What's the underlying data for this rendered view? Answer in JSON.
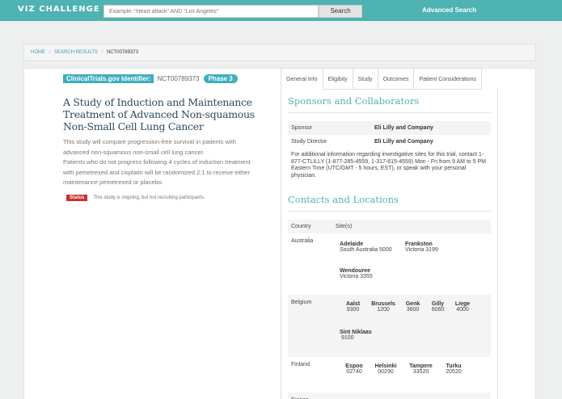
{
  "header": {
    "brand": "VIZ CHALLENGE",
    "search_placeholder": "Example: \"Heart attack\" AND \"Los Angeles\"",
    "search_button": "Search",
    "advanced_search": "Advanced Search"
  },
  "breadcrumb": {
    "home": "HOME",
    "separator": "/",
    "results": "SEARCH RESULTS",
    "current": "NCT00789373"
  },
  "study": {
    "id_label": "ClinicalTrials.gov Identifier:",
    "id_value": "NCT00789373",
    "phase": "Phase 3",
    "title": "A Study of Induction and Maintenance Treatment of Advanced Non-squamous Non-Small Cell Lung Cancer",
    "summary": "This study will compare progression-free survival in patients with advanced non-squamous non-small cell lung cancer.",
    "detail": "Patients who do not progress following 4 cycles of induction treatment with pemetrexed and cisplatin will be randomized 2:1 to receive either maintenance pemetrexed or placebo.",
    "status_label": "Status",
    "status_text": "This study is ongoing, but not recruiting participants."
  },
  "tabs": [
    "General Info",
    "Eligibity",
    "Study",
    "Outcomes",
    "Patient Considerations"
  ],
  "sponsors": {
    "heading": "Sponsors and Collaborators",
    "sponsor_label": "Sponsor",
    "sponsor_value": "Eli Lilly and Company",
    "director_label": "Study Director",
    "director_value": "Eli Lilly and Company",
    "note": "For additional information regarding investigative sites for this trial, contact 1-877-CTLILLY (1-877-285-4559, 1-317-615-4559) Mon - Fri from 9 AM to 5 PM Eastern Time (UTC/GMT - 5 hours, EST), or speak with your personal physician."
  },
  "locations": {
    "heading": "Contacts and Locations",
    "col_country": "Country",
    "col_sites": "Site(s)",
    "countries": [
      {
        "name": "Australia",
        "sites": [
          {
            "city": "Adelaide",
            "post": "South Australia 5000"
          },
          {
            "city": "Frankston",
            "post": "Victoria 3199"
          },
          {
            "city": "Wendouree",
            "post": "Victoria 3355"
          }
        ]
      },
      {
        "name": "Belgium",
        "sites": [
          {
            "city": "Aalst",
            "post": "9300"
          },
          {
            "city": "Brussels",
            "post": "1200"
          },
          {
            "city": "Genk",
            "post": "3600"
          },
          {
            "city": "Gilly",
            "post": "6060"
          },
          {
            "city": "Liege",
            "post": "4000"
          },
          {
            "city": "Sint Niklaas",
            "post": "9100"
          }
        ]
      },
      {
        "name": "Finland",
        "sites": [
          {
            "city": "Espoo",
            "post": "02740"
          },
          {
            "city": "Helsinki",
            "post": "00290"
          },
          {
            "city": "Tampere",
            "post": "33520"
          },
          {
            "city": "Turku",
            "post": "20520"
          }
        ]
      },
      {
        "name": "France",
        "sites": []
      }
    ]
  }
}
